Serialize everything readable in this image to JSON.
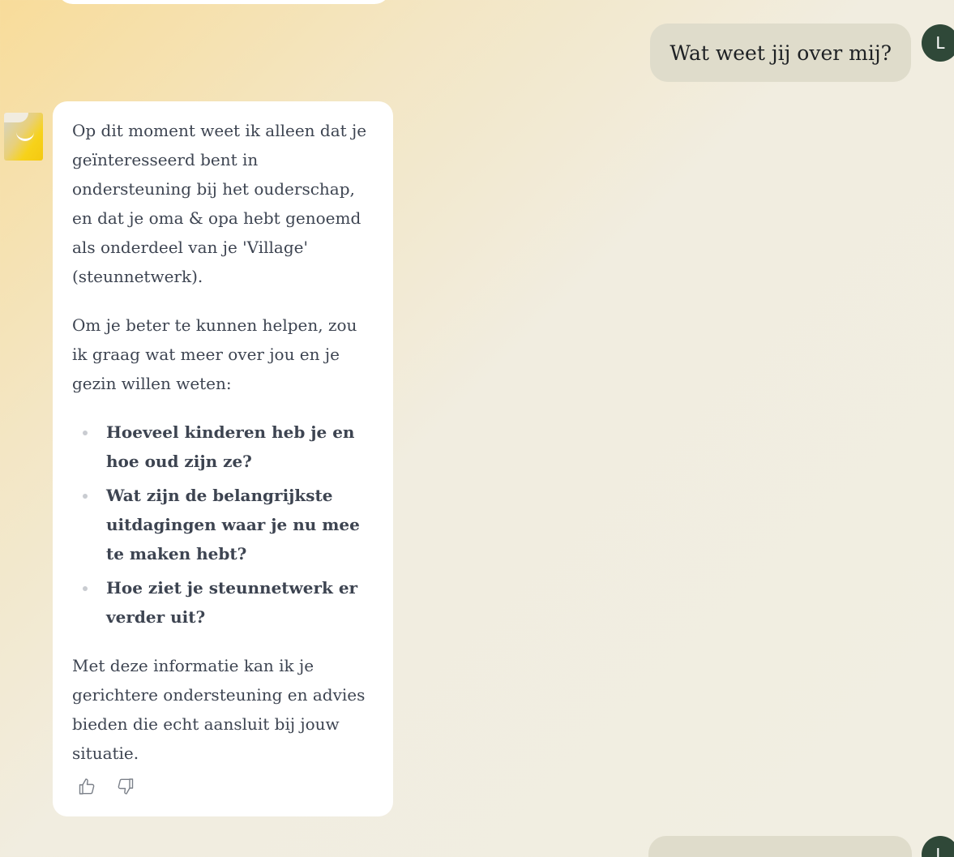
{
  "user_message": {
    "text": "Wat weet jij over mij?",
    "avatar_initial": "L"
  },
  "assistant_message": {
    "paragraph_1": "Op dit moment weet ik alleen dat je geïnteresseerd bent in ondersteuning bij het ouderschap, en dat je oma & opa hebt genoemd als onderdeel van je 'Village' (steunnetwerk).",
    "paragraph_2": "Om je beter te kunnen helpen, zou ik graag wat meer over jou en je gezin willen weten:",
    "questions": [
      "Hoeveel kinderen heb je en hoe oud zijn ze?",
      "Wat zijn de belangrijkste uitdagingen waar je nu mee te maken hebt?",
      "Hoe ziet je steunnetwerk er verder uit?"
    ],
    "paragraph_3": "Met deze informatie kan ik je gerichtere ondersteuning en advies bieden die echt aansluit bij jouw situatie.",
    "feedback_icons": [
      "thumbs-up-icon",
      "thumbs-down-icon"
    ]
  },
  "next_user_message": {
    "avatar_initial": "L"
  },
  "colors": {
    "user_bubble": "#dfdccb",
    "user_avatar": "#2f4838",
    "assistant_bubble": "#ffffff",
    "assistant_text": "#3d4451",
    "background_warm": "#f8dc9a",
    "background_light": "#f1eee2"
  }
}
